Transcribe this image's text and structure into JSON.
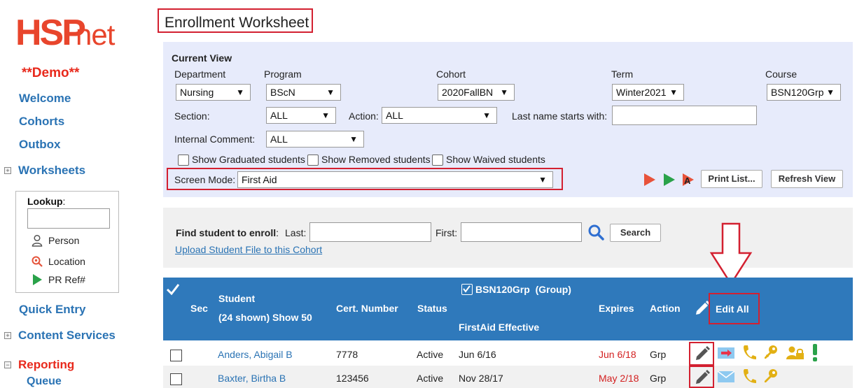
{
  "sidebar": {
    "logo_hsp": "HSP",
    "logo_net": "net",
    "demo": "**Demo**",
    "nav": {
      "welcome": "Welcome",
      "cohorts": "Cohorts",
      "outbox": "Outbox",
      "worksheets": "Worksheets",
      "quick_entry": "Quick Entry",
      "content_services": "Content Services",
      "reporting": "Reporting",
      "queue": "Queue"
    },
    "lookup": {
      "label": "Lookup",
      "colon": ":",
      "person": "Person",
      "location": "Location",
      "pr_ref": "PR Ref#"
    }
  },
  "page_title": "Enrollment Worksheet",
  "current_view": {
    "heading": "Current View",
    "department_label": "Department",
    "department_value": "Nursing",
    "program_label": "Program",
    "program_value": "BScN",
    "cohort_label": "Cohort",
    "cohort_value": "2020FallBN",
    "term_label": "Term",
    "term_value": "Winter2021",
    "course_label": "Course",
    "course_value": "BSN120Grp",
    "section_label": "Section:",
    "section_value": "ALL",
    "action_label": "Action:",
    "action_value": "ALL",
    "lastname_label": "Last name starts with:",
    "internal_comment_label": "Internal Comment:",
    "internal_comment_value": "ALL",
    "show_graduated": "Show Graduated students",
    "show_removed": "Show Removed students",
    "show_waived": "Show Waived students",
    "screen_mode_label": "Screen Mode:",
    "screen_mode_value": "First Aid",
    "print_list": "Print List...",
    "refresh_view": "Refresh View"
  },
  "find_student": {
    "label": "Find student to enroll",
    "colon": ":",
    "last_label": "Last:",
    "first_label": "First:",
    "search_button": "Search",
    "upload_link": "Upload Student File to this Cohort"
  },
  "table": {
    "headers": {
      "sec": "Sec",
      "student": "Student",
      "shown": "(24 shown) Show 50",
      "cert_number": "Cert. Number",
      "status": "Status",
      "course_group": "BSN120Grp  (Group)",
      "firstaid_effective": "FirstAid Effective",
      "expires": "Expires",
      "action": "Action",
      "edit_all": "Edit All"
    },
    "rows": [
      {
        "student": "Anders, Abigail B",
        "cert": "7778",
        "status": "Active",
        "effective": "Jun 6/16",
        "expires": "Jun 6/18",
        "action": "Grp"
      },
      {
        "student": "Baxter, Birtha B",
        "cert": "123456",
        "status": "Active",
        "effective": "Nov 28/17",
        "expires": "May 2/18",
        "action": "Grp"
      }
    ]
  },
  "colors": {
    "brand_red": "#e8452c",
    "link_blue": "#2a73b4",
    "header_blue": "#2f79bb",
    "highlight_red": "#d32030",
    "panel_bg": "#e7ebfb",
    "icon_gold": "#e2b014",
    "icon_green": "#2aa24a"
  },
  "icons": [
    "person-icon",
    "location-icon",
    "play-icon",
    "search-icon",
    "checkmark-icon",
    "pencil-icon",
    "arrow-down-icon",
    "mail-icon",
    "phone-icon",
    "key-icon",
    "lock-user-icon",
    "exclamation-icon"
  ]
}
